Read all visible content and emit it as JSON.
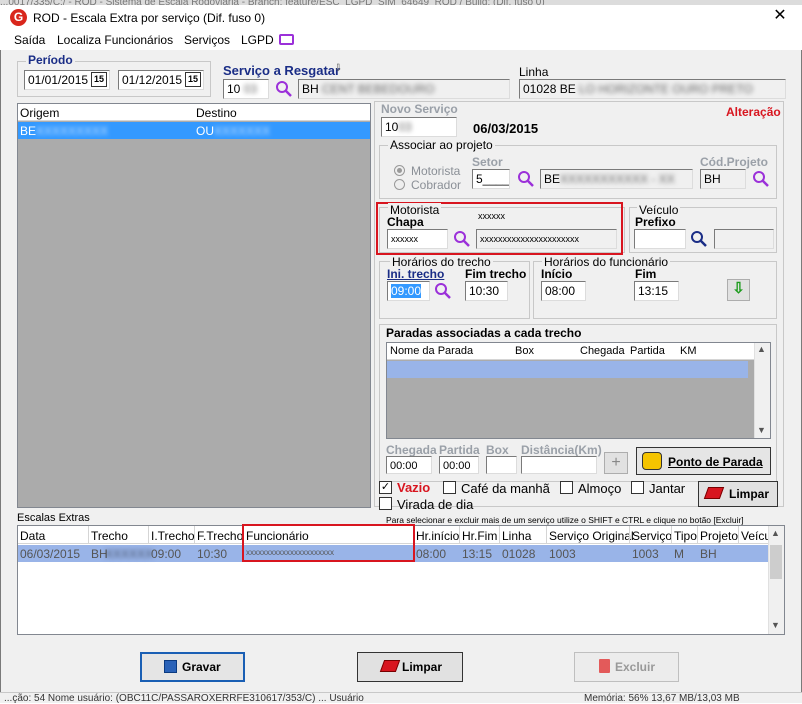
{
  "window": {
    "background_title": "...0017/335/C:/ - ROD - Sistema de Escala Rodoviária - Branch: feature/ESC_LGPD_SIM_64649_ROD / Build: (Dif. fuso 0)",
    "title": "ROD - Escala Extra por serviço (Dif. fuso 0)",
    "close": "✕"
  },
  "menu": {
    "items": [
      "Saída",
      "Localiza Funcionários",
      "Serviços",
      "LGPD"
    ]
  },
  "periodo": {
    "label": "Período",
    "start": "01/01/2015",
    "end": "01/12/2015",
    "cal": "15"
  },
  "servico_resgatar": {
    "label": "Serviço a Resgatar",
    "code": "10",
    "name": "BH"
  },
  "linha": {
    "label": "Linha",
    "value": "01028 BE"
  },
  "origem_destino": {
    "headers": [
      "Origem",
      "Destino"
    ],
    "rows": [
      {
        "origem": "BE",
        "destino": "OU"
      }
    ]
  },
  "novo_servico": {
    "label": "Novo Serviço",
    "value": "10",
    "date": "06/03/2015",
    "status": "Alteração"
  },
  "associar": {
    "label": "Associar ao projeto",
    "radio1": "Motorista",
    "radio2": "Cobrador",
    "setor_label": "Setor",
    "setor_value": "5____",
    "setor_name": "BE",
    "cod_label": "Cód.Projeto",
    "cod_value": "BH"
  },
  "motorista": {
    "label": "Motorista",
    "chapa_label": "Chapa",
    "chapa_value": "xxxxxx",
    "top_mask": "xxxxxx",
    "name_value": "xxxxxxxxxxxxxxxxxxxxxx"
  },
  "veiculo": {
    "label": "Veículo",
    "prefixo_label": "Prefixo"
  },
  "horarios_trecho": {
    "label": "Horários do trecho",
    "ini_label": "Ini. trecho",
    "ini_value": "09:00",
    "fim_label": "Fim trecho",
    "fim_value": "10:30"
  },
  "horarios_func": {
    "label": "Horários do funcionário",
    "inicio_label": "Início",
    "inicio_value": "08:00",
    "fim_label": "Fim",
    "fim_value": "13:15"
  },
  "paradas": {
    "label": "Paradas associadas a cada trecho",
    "headers": [
      "Nome da Parada",
      "Box",
      "Chegada",
      "Partida",
      "KM"
    ],
    "chegada_label": "Chegada",
    "partida_label": "Partida",
    "box_label": "Box",
    "distancia_label": "Distância(Km)",
    "chegada_value": "00:00",
    "partida_value": "00:00",
    "ponto_button": "Ponto de Parada",
    "plus": "+"
  },
  "extras": {
    "vazio": "Vazio",
    "cafe": "Café da manhã",
    "almoco": "Almoço",
    "jantar": "Jantar",
    "virada": "Virada de dia",
    "limpar": "Limpar"
  },
  "escalas": {
    "label": "Escalas Extras",
    "hint": "Para selecionar e excluir mais de um serviço utilize o SHIFT e CTRL e clique no botão [Excluir]",
    "headers": [
      "Data",
      "Trecho",
      "I.Trecho",
      "F.Trecho",
      "Funcionário",
      "Hr.início",
      "Hr.Fim",
      "Linha",
      "Serviço Original",
      "Serviço",
      "Tipo",
      "Projeto",
      "Veícu"
    ],
    "row": [
      "06/03/2015",
      "BH",
      "09:00",
      "10:30",
      "xxxxxxxxxxxxxxxxxxxxxx",
      "08:00",
      "13:15",
      "01028",
      "1003",
      "1003",
      "M",
      "BH",
      ""
    ]
  },
  "buttons": {
    "gravar": "Gravar",
    "limpar": "Limpar",
    "excluir": "Excluir"
  },
  "status": {
    "left": "...ção: 54 Nome usuário: (OBC11C/PASSAROXERRFE310617/353/C) ... Usuário",
    "right": "Memória: 56%  13,67 MB/13,03 MB"
  },
  "colors": {
    "accent_blue": "#3399ff",
    "row_select": "#99b4e8",
    "red": "#d8151f",
    "title_blue": "#1a2d86"
  }
}
